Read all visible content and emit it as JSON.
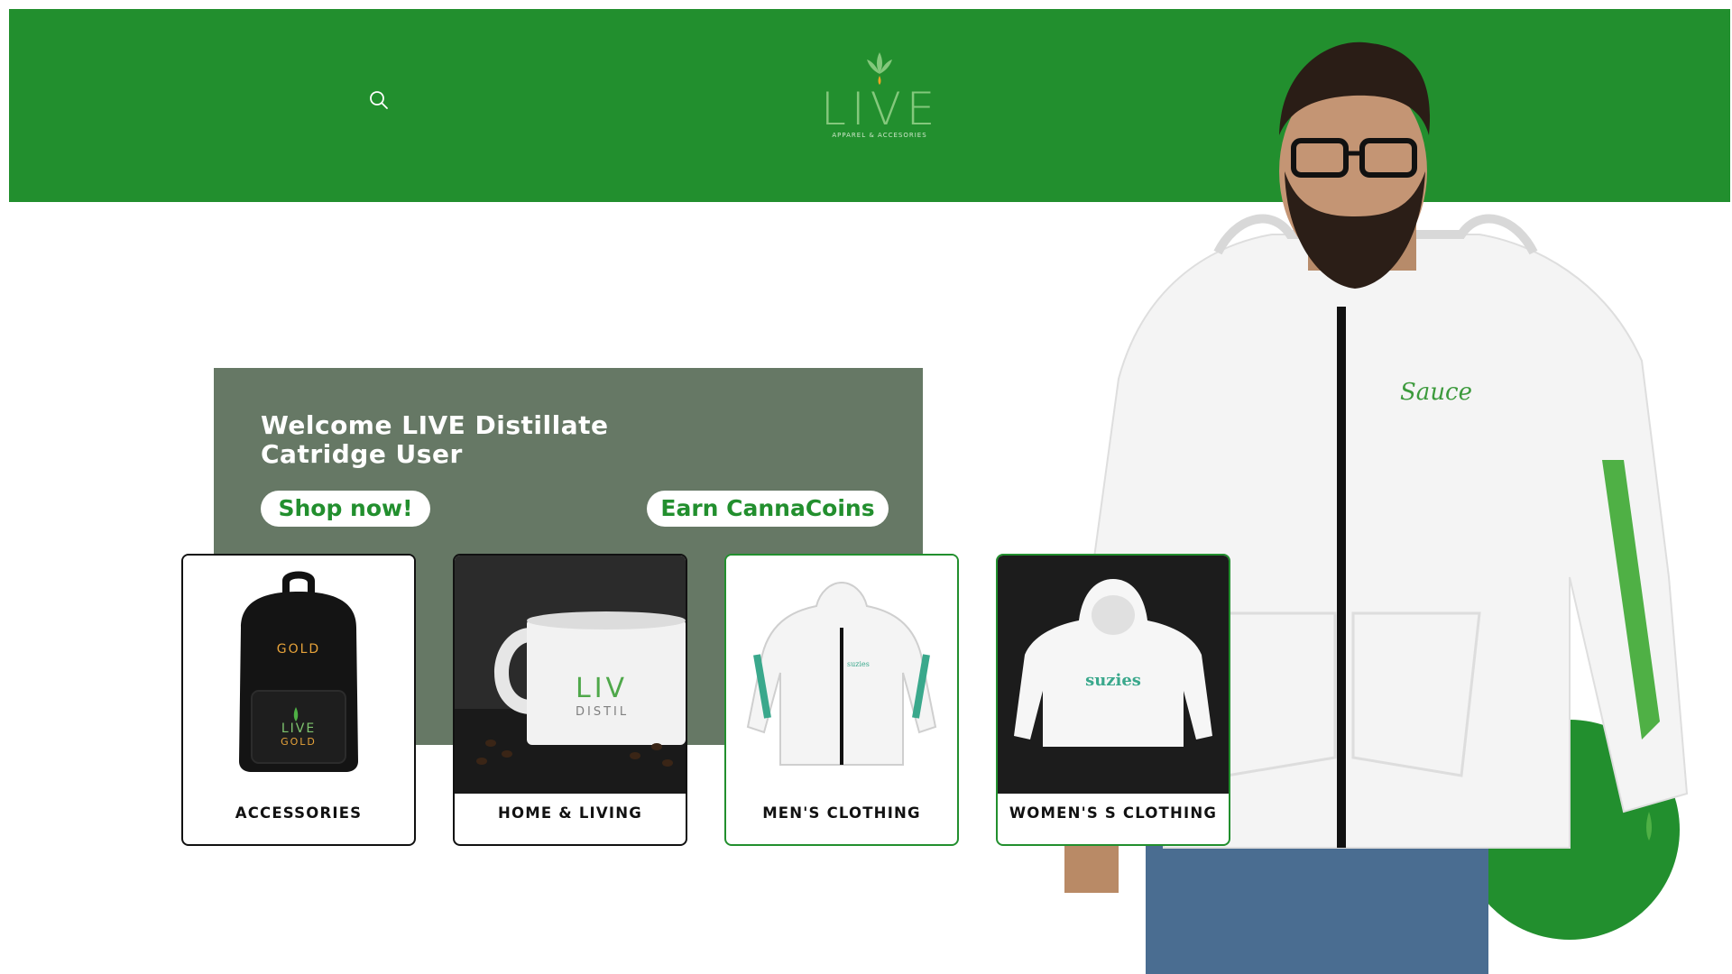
{
  "header": {
    "logo_word": "LIVE",
    "logo_tagline": "APPAREL & ACCESORIES",
    "search_icon": "search-icon"
  },
  "hero": {
    "title_line1": "Welcome LIVE Distillate",
    "title_line2": "Catridge User",
    "shop_label": "Shop now!",
    "earn_label": "Earn CannaCoins",
    "hoodie_text": "Sauce"
  },
  "categories": [
    {
      "label": "ACCESSORIES",
      "image_text_top": "GOLD",
      "image_text_logo": "LIVE",
      "image_text_sub": "GOLD"
    },
    {
      "label": "HOME & LIVING",
      "image_text_top": "LIV",
      "image_text_sub": "DISTIL"
    },
    {
      "label": "MEN'S CLOTHING",
      "image_text_top": "suzies"
    },
    {
      "label": "WOMEN'S S CLOTHING",
      "image_text_top": "suzies"
    }
  ],
  "colors": {
    "brand_green": "#228f2e",
    "panel_gray_green": "#667865",
    "logo_light_green": "#84c87c"
  }
}
